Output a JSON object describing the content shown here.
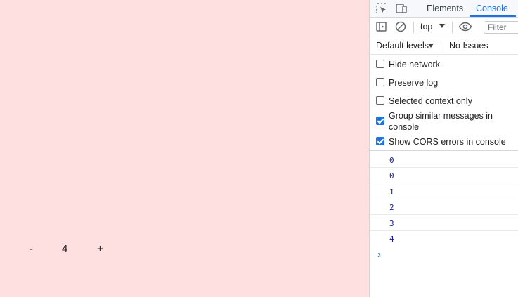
{
  "page": {
    "counter": {
      "minus_label": "-",
      "value": "4",
      "plus_label": "+"
    }
  },
  "devtools": {
    "tabs": [
      {
        "label": "Elements",
        "active": false
      },
      {
        "label": "Console",
        "active": true
      }
    ],
    "toolbar": {
      "context": "top",
      "filter_placeholder": "Filter"
    },
    "levels": {
      "label": "Default levels",
      "issues": "No Issues"
    },
    "settings": [
      {
        "label": "Hide network",
        "checked": false
      },
      {
        "label": "Preserve log",
        "checked": false
      },
      {
        "label": "Selected context only",
        "checked": false
      },
      {
        "label": "Group similar messages in console",
        "checked": true
      },
      {
        "label": "Show CORS errors in console",
        "checked": true
      }
    ],
    "console_logs": [
      "0",
      "0",
      "1",
      "2",
      "3",
      "4"
    ],
    "prompt_symbol": "›"
  },
  "colors": {
    "page_background": "#ffe0e0",
    "accent": "#1a73e8",
    "log_value": "#1a1aa6"
  },
  "icons": [
    "inspect-icon",
    "device-toolbar-icon",
    "sidebar-toggle-icon",
    "clear-console-icon",
    "eye-icon"
  ]
}
